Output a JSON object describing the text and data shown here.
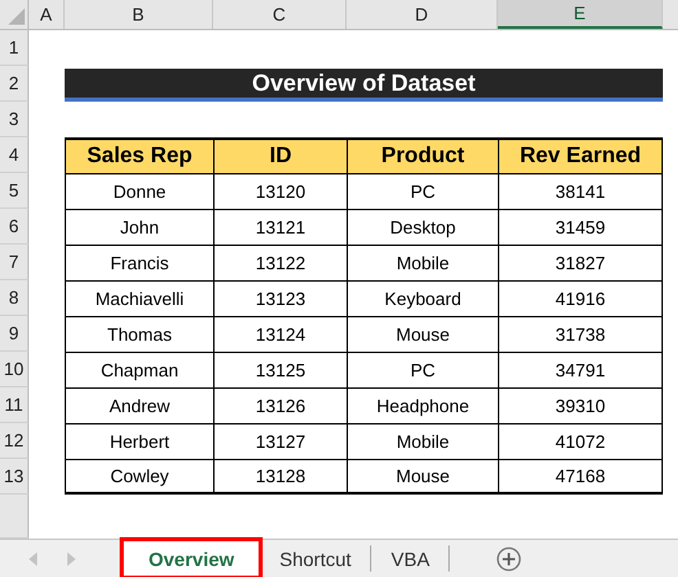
{
  "columns": [
    {
      "label": "A",
      "selected": false
    },
    {
      "label": "B",
      "selected": false
    },
    {
      "label": "C",
      "selected": false
    },
    {
      "label": "D",
      "selected": false
    },
    {
      "label": "E",
      "selected": true
    }
  ],
  "row_numbers": [
    "1",
    "2",
    "3",
    "4",
    "5",
    "6",
    "7",
    "8",
    "9",
    "10",
    "11",
    "12",
    "13"
  ],
  "title": "Overview of Dataset",
  "table": {
    "columns": [
      "Sales Rep",
      "ID",
      "Product",
      "Rev Earned"
    ],
    "rows": [
      [
        "Donne",
        "13120",
        "PC",
        "38141"
      ],
      [
        "John",
        "13121",
        "Desktop",
        "31459"
      ],
      [
        "Francis",
        "13122",
        "Mobile",
        "31827"
      ],
      [
        "Machiavelli",
        "13123",
        "Keyboard",
        "41916"
      ],
      [
        "Thomas",
        "13124",
        "Mouse",
        "31738"
      ],
      [
        "Chapman",
        "13125",
        "PC",
        "34791"
      ],
      [
        "Andrew",
        "13126",
        "Headphone",
        "39310"
      ],
      [
        "Herbert",
        "13127",
        "Mobile",
        "41072"
      ],
      [
        "Cowley",
        "13128",
        "Mouse",
        "47168"
      ]
    ]
  },
  "sheet_tabs": [
    {
      "label": "Overview",
      "selected": true,
      "highlighted": true
    },
    {
      "label": "Shortcut",
      "selected": false,
      "highlighted": false
    },
    {
      "label": "VBA",
      "selected": false,
      "highlighted": false
    }
  ]
}
